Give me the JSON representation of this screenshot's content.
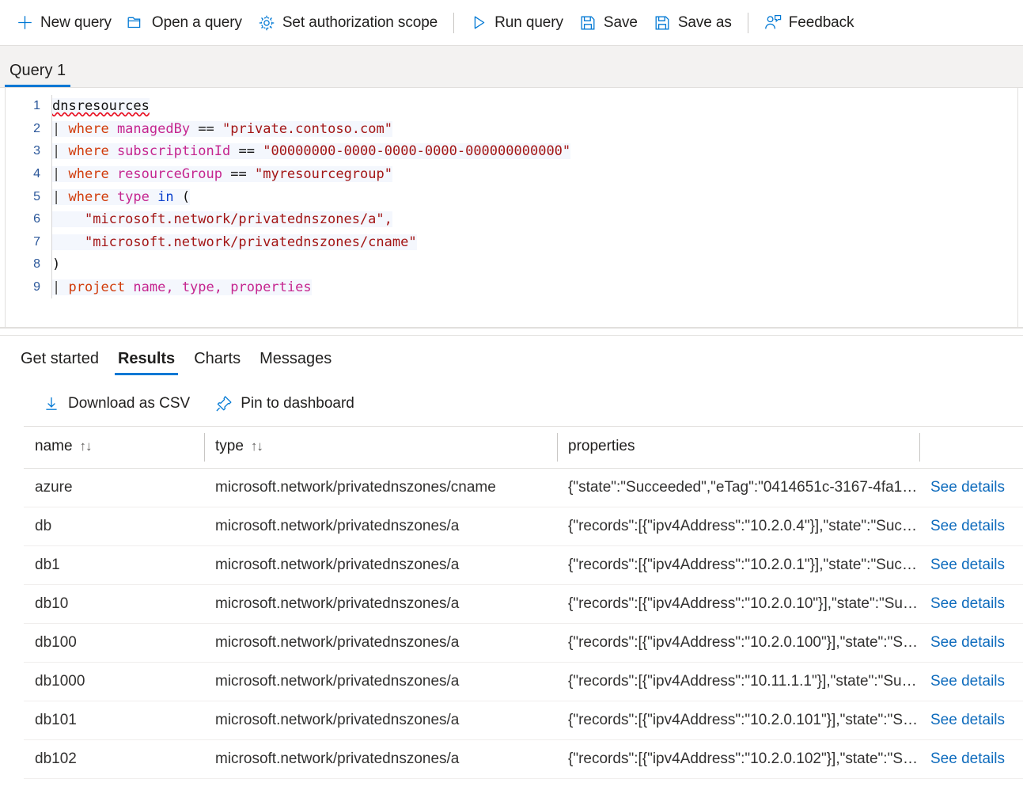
{
  "toolbar": {
    "buttons": [
      {
        "label": "New query",
        "icon": "plus-icon"
      },
      {
        "label": "Open a query",
        "icon": "folder-open-icon"
      },
      {
        "label": "Set authorization scope",
        "icon": "gear-icon"
      },
      {
        "label": "Run query",
        "icon": "play-icon"
      },
      {
        "label": "Save",
        "icon": "save-icon"
      },
      {
        "label": "Save as",
        "icon": "save-as-icon"
      },
      {
        "label": "Feedback",
        "icon": "person-feedback-icon"
      }
    ]
  },
  "query_tab": {
    "label": "Query 1"
  },
  "editor": {
    "lines": [
      {
        "num": "1",
        "highlight": true
      },
      {
        "num": "2",
        "highlight": true
      },
      {
        "num": "3",
        "highlight": true
      },
      {
        "num": "4",
        "highlight": true
      },
      {
        "num": "5",
        "highlight": true
      },
      {
        "num": "6",
        "highlight": true
      },
      {
        "num": "7",
        "highlight": true
      },
      {
        "num": "8",
        "highlight": false
      },
      {
        "num": "9",
        "highlight": true
      }
    ],
    "code": {
      "l1_table": "dnsresources",
      "l2_kw": "where",
      "l2_id": "managedBy",
      "l2_op": "==",
      "l2_str": "\"private.contoso.com\"",
      "l3_kw": "where",
      "l3_id": "subscriptionId",
      "l3_op": "==",
      "l3_str": "\"00000000-0000-0000-0000-000000000000\"",
      "l4_kw": "where",
      "l4_id": "resourceGroup",
      "l4_op": "==",
      "l4_str": "\"myresourcegroup\"",
      "l5_kw": "where",
      "l5_id": "type",
      "l5_in": "in",
      "l5_paren": "(",
      "l6_str": "\"microsoft.network/privatednszones/a\",",
      "l7_str": "\"microsoft.network/privatednszones/cname\"",
      "l8_paren": ")",
      "l9_kw": "project",
      "l9_cols": "name, type, properties",
      "pipe": "|"
    }
  },
  "results": {
    "tabs": [
      {
        "label": "Get started",
        "active": false
      },
      {
        "label": "Results",
        "active": true
      },
      {
        "label": "Charts",
        "active": false
      },
      {
        "label": "Messages",
        "active": false
      }
    ],
    "actions": [
      {
        "label": "Download as CSV",
        "icon": "download-icon"
      },
      {
        "label": "Pin to dashboard",
        "icon": "pin-icon"
      }
    ],
    "columns": [
      {
        "label": "name",
        "sortable": true
      },
      {
        "label": "type",
        "sortable": true
      },
      {
        "label": "properties",
        "sortable": false
      },
      {
        "label": "",
        "sortable": false
      }
    ],
    "sort_glyph": "↑↓",
    "details_label": "See details",
    "rows": [
      {
        "name": "azure",
        "type": "microsoft.network/privatednszones/cname",
        "properties": "{\"state\":\"Succeeded\",\"eTag\":\"0414651c-3167-4fa1-…"
      },
      {
        "name": "db",
        "type": "microsoft.network/privatednszones/a",
        "properties": "{\"records\":[{\"ipv4Address\":\"10.2.0.4\"}],\"state\":\"Succ…"
      },
      {
        "name": "db1",
        "type": "microsoft.network/privatednszones/a",
        "properties": "{\"records\":[{\"ipv4Address\":\"10.2.0.1\"}],\"state\":\"Succ…"
      },
      {
        "name": "db10",
        "type": "microsoft.network/privatednszones/a",
        "properties": "{\"records\":[{\"ipv4Address\":\"10.2.0.10\"}],\"state\":\"Suc…"
      },
      {
        "name": "db100",
        "type": "microsoft.network/privatednszones/a",
        "properties": "{\"records\":[{\"ipv4Address\":\"10.2.0.100\"}],\"state\":\"Su…"
      },
      {
        "name": "db1000",
        "type": "microsoft.network/privatednszones/a",
        "properties": "{\"records\":[{\"ipv4Address\":\"10.11.1.1\"}],\"state\":\"Suc…"
      },
      {
        "name": "db101",
        "type": "microsoft.network/privatednszones/a",
        "properties": "{\"records\":[{\"ipv4Address\":\"10.2.0.101\"}],\"state\":\"Su…"
      },
      {
        "name": "db102",
        "type": "microsoft.network/privatednszones/a",
        "properties": "{\"records\":[{\"ipv4Address\":\"10.2.0.102\"}],\"state\":\"Su…"
      }
    ]
  },
  "colors": {
    "accent": "#0078d4",
    "link": "#0f6cbd",
    "keyword": "#d13b0a",
    "identifier": "#c5258f",
    "string": "#a31515",
    "operator_in": "#0b41cd",
    "gutter": "#2b579a",
    "error_squiggle": "#e81123"
  }
}
